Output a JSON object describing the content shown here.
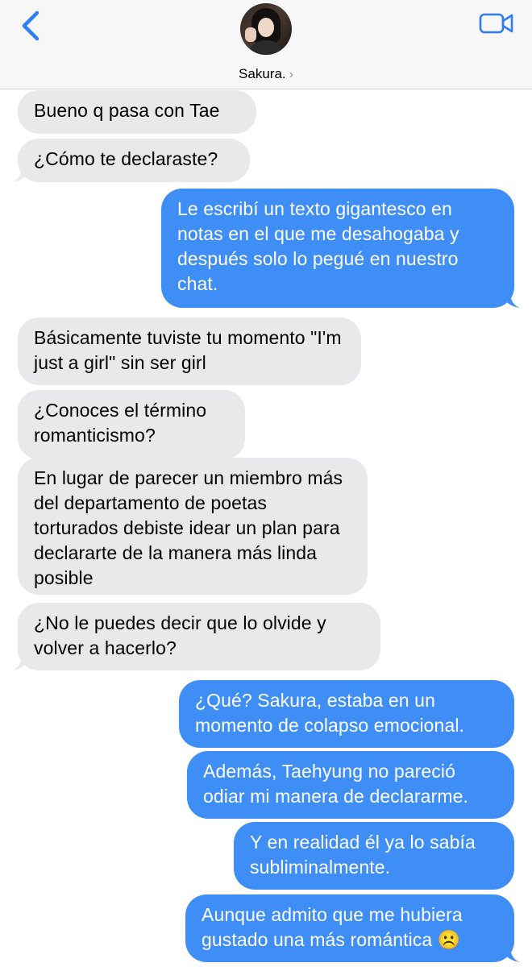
{
  "header": {
    "back_icon": "chevron-left-icon",
    "contact_name": "Sakura.",
    "name_chevron": "›",
    "video_icon": "video-camera-icon",
    "accent_color": "#2f7cf6"
  },
  "colors": {
    "incoming_bubble": "#e9e9eb",
    "outgoing_bubble": "#3f8ef5"
  },
  "messages": [
    {
      "from": "them",
      "text": "Bueno q pasa con Tae"
    },
    {
      "from": "them",
      "text": "¿Cómo te declaraste?"
    },
    {
      "from": "me",
      "text": "Le escribí un texto gigantesco en notas en el que me desahogaba y después solo lo pegué en nuestro chat."
    },
    {
      "from": "them",
      "text": "Básicamente tuviste tu momento \"I'm just a girl\" sin ser girl"
    },
    {
      "from": "them",
      "text": "¿Conoces el término romanticismo?"
    },
    {
      "from": "them",
      "text": "En lugar de parecer un miembro más del departamento de poetas torturados debiste idear un plan para declararte de la manera más linda posible"
    },
    {
      "from": "them",
      "text": "¿No le puedes decir que lo olvide y volver a hacerlo?"
    },
    {
      "from": "me",
      "text": "¿Qué? Sakura, estaba en un momento de colapso emocional."
    },
    {
      "from": "me",
      "text": "Además, Taehyung no pareció odiar mi manera de declararme."
    },
    {
      "from": "me",
      "text": "Y en realidad él ya lo sabía subliminalmente."
    },
    {
      "from": "me",
      "text": "Aunque admito que me hubiera gustado una más romántica ☹️"
    }
  ]
}
